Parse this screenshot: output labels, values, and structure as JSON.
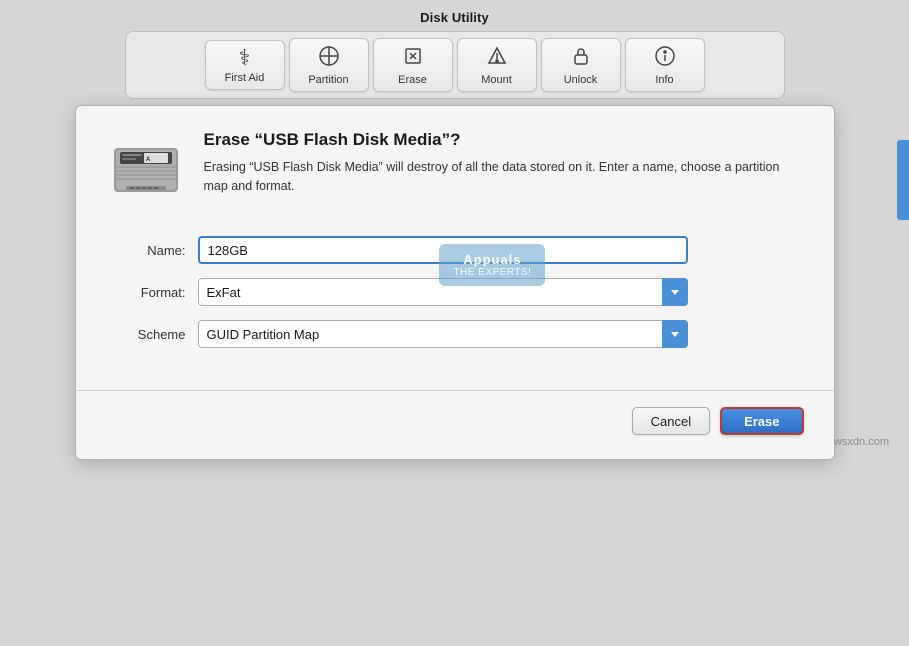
{
  "app": {
    "title": "Disk Utility"
  },
  "toolbar": {
    "buttons": [
      {
        "id": "first-aid",
        "label": "First Aid",
        "icon": "⚕"
      },
      {
        "id": "partition",
        "label": "Partition",
        "icon": "⊕"
      },
      {
        "id": "erase",
        "label": "Erase",
        "icon": "✎"
      },
      {
        "id": "mount",
        "label": "Mount",
        "icon": "⇪"
      },
      {
        "id": "unlock",
        "label": "Unlock",
        "icon": "🔒"
      },
      {
        "id": "info",
        "label": "Info",
        "icon": "ℹ"
      }
    ]
  },
  "dialog": {
    "title": "Erase “USB Flash Disk Media”?",
    "description": "Erasing “USB Flash Disk Media” will destroy of all the data stored on it. Enter a name, choose a partition map and format.",
    "fields": {
      "name_label": "Name:",
      "name_value": "128GB",
      "format_label": "Format:",
      "format_value": "ExFat",
      "scheme_label": "Scheme",
      "scheme_value": "GUID Partition Map"
    },
    "buttons": {
      "cancel": "Cancel",
      "erase": "Erase"
    }
  },
  "watermark": {
    "line1": "Appuals",
    "line2": "THE EXPERTS!"
  },
  "bottom": {
    "url": "wsxdn.com"
  }
}
